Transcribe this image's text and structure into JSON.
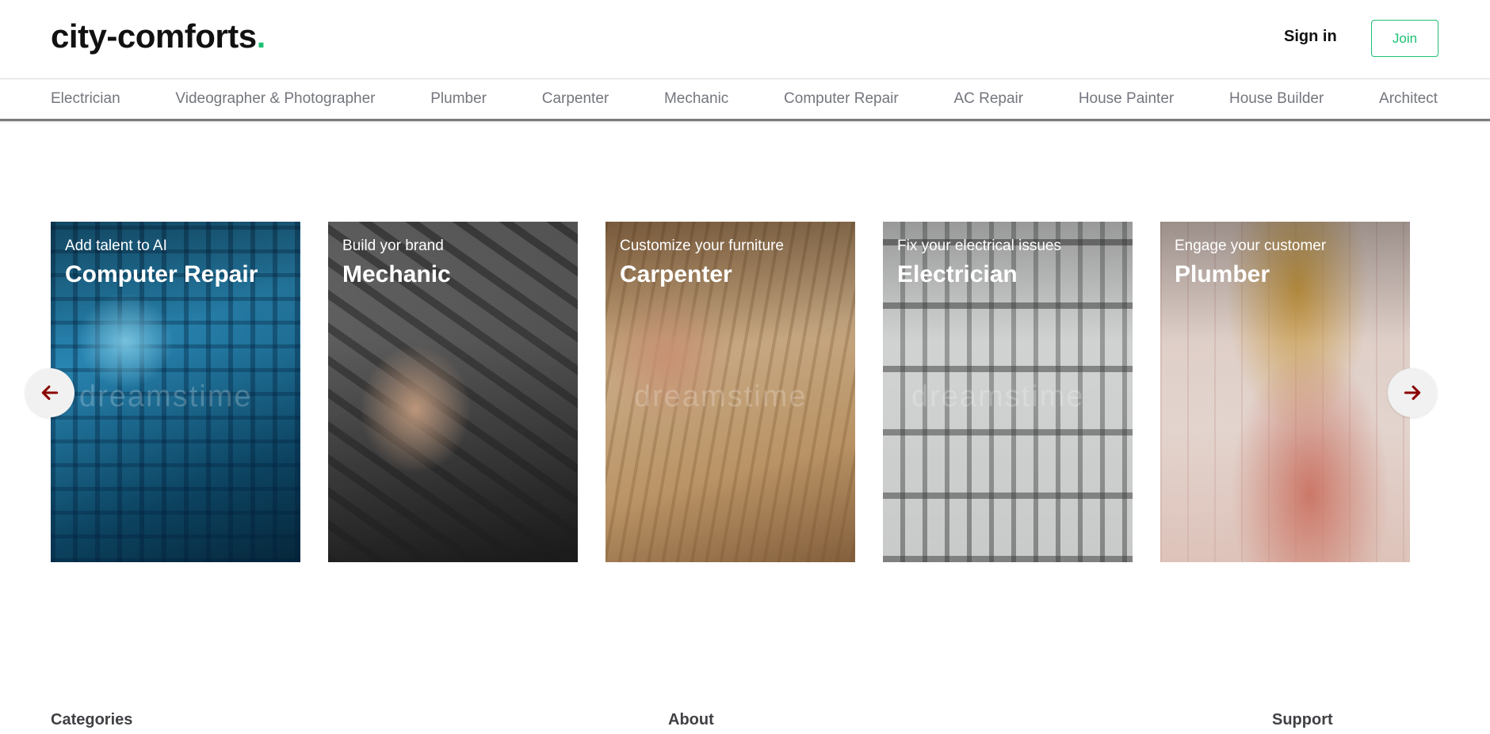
{
  "header": {
    "logo_text": "city-comforts",
    "logo_dot": ".",
    "signin_label": "Sign in",
    "join_label": "Join",
    "accent_color": "#1dbf73"
  },
  "categories_nav": {
    "items": [
      "Electrician",
      "Videographer & Photographer",
      "Plumber",
      "Carpenter",
      "Mechanic",
      "Computer Repair",
      "AC Repair",
      "House Painter",
      "House Builder",
      "Architect"
    ]
  },
  "carousel": {
    "cards": [
      {
        "subtitle": "Add talent to AI",
        "title": "Computer Repair",
        "watermark": "dreamstime"
      },
      {
        "subtitle": "Build yor brand",
        "title": "Mechanic",
        "watermark": ""
      },
      {
        "subtitle": "Customize your furniture",
        "title": "Carpenter",
        "watermark": "dreamstime"
      },
      {
        "subtitle": "Fix your electrical issues",
        "title": "Electrician",
        "watermark": "dreamstime"
      },
      {
        "subtitle": "Engage your customer",
        "title": "Plumber",
        "watermark": ""
      }
    ],
    "prev_icon": "arrow-left-icon",
    "next_icon": "arrow-right-icon",
    "arrow_color": "#8b0000"
  },
  "footer": {
    "headings": [
      "Categories",
      "About",
      "Support"
    ]
  }
}
